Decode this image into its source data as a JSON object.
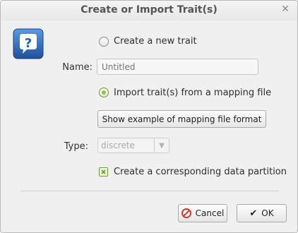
{
  "window": {
    "title": "Create or Import Trait(s)"
  },
  "options": {
    "create_label": "Create a new trait",
    "import_label": "Import trait(s) from a mapping file",
    "selected": "import"
  },
  "name_field": {
    "label": "Name:",
    "placeholder": "Untitled"
  },
  "example_button": {
    "label": "Show example of mapping file format"
  },
  "type_field": {
    "label": "Type:",
    "value": "discrete"
  },
  "partition_checkbox": {
    "label": "Create a corresponding data partition",
    "checked": true
  },
  "buttons": {
    "cancel": "Cancel",
    "ok": "OK"
  },
  "colors": {
    "accent_green": "#8fc43a",
    "cancel_red": "#d23a2a",
    "icon_blue": "#2f6fbf"
  },
  "icons": [
    "help-question-icon",
    "close-icon",
    "cancel-icon",
    "check-icon",
    "dropdown-arrow-icon"
  ]
}
